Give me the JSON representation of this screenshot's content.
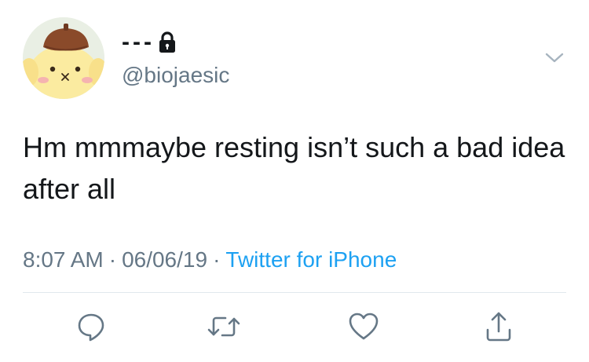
{
  "tweet": {
    "display_name": "---",
    "handle": "@biojaesic",
    "text": "Hm mmmaybe resting isn’t such a bad idea after all",
    "time": "8:07 AM",
    "separator": "·",
    "date": "06/06/19",
    "source": "Twitter for iPhone"
  },
  "icons": {
    "avatar": "pompompurin-avatar",
    "lock": "lock-icon",
    "menu": "chevron-down-icon",
    "actions": [
      "reply-icon",
      "retweet-icon",
      "like-icon",
      "share-icon"
    ]
  },
  "colors": {
    "text": "#14171a",
    "secondary": "#657786",
    "link": "#1da1f2",
    "divider": "#e1e8ed"
  }
}
